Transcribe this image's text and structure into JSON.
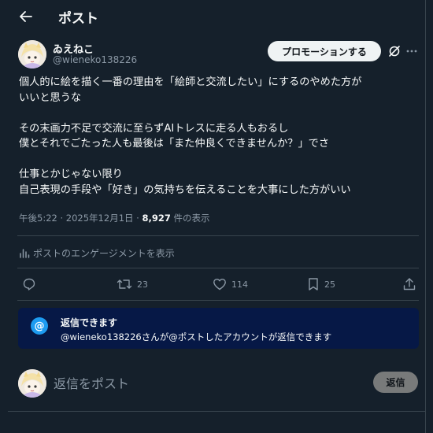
{
  "header": {
    "title": "ポスト"
  },
  "post": {
    "author_name": "ゐえねこ",
    "author_handle": "@wieneko138226",
    "promote_label": "プロモーションする",
    "lines": [
      "個人的に絵を描く一番の理由を「絵師と交流したい」にするのやめた方が",
      "いいと思うな",
      "",
      "その末画力不足で交流に至らずAIトレスに走る人もおるし",
      "僕とそれでごたった人も最後は「また仲良くできませんか？」でさ",
      "",
      "仕事とかじゃない限り",
      "自己表現の手段や「好き」の気持ちを伝えることを大事にした方がいい"
    ],
    "time": "午後5:22 · 2025年12月1日 · ",
    "views": "8,927",
    "views_suffix": " 件の表示"
  },
  "engagement": {
    "label": "ポストのエンゲージメントを表示"
  },
  "actions": {
    "reply_count": "",
    "repost_count": "23",
    "like_count": "114",
    "bookmark_count": "25"
  },
  "reply_notice": {
    "title": "返信できます",
    "body": "@wieneko138226さんが@ポストしたアカウントが返信できます",
    "badge": "@"
  },
  "reply_box": {
    "placeholder": "返信をポスト",
    "button_label": "返信"
  },
  "colors": {
    "background": "#15202b",
    "accent": "#1d9bf0",
    "notice_bg": "#061846",
    "muted": "#8b98a5"
  }
}
